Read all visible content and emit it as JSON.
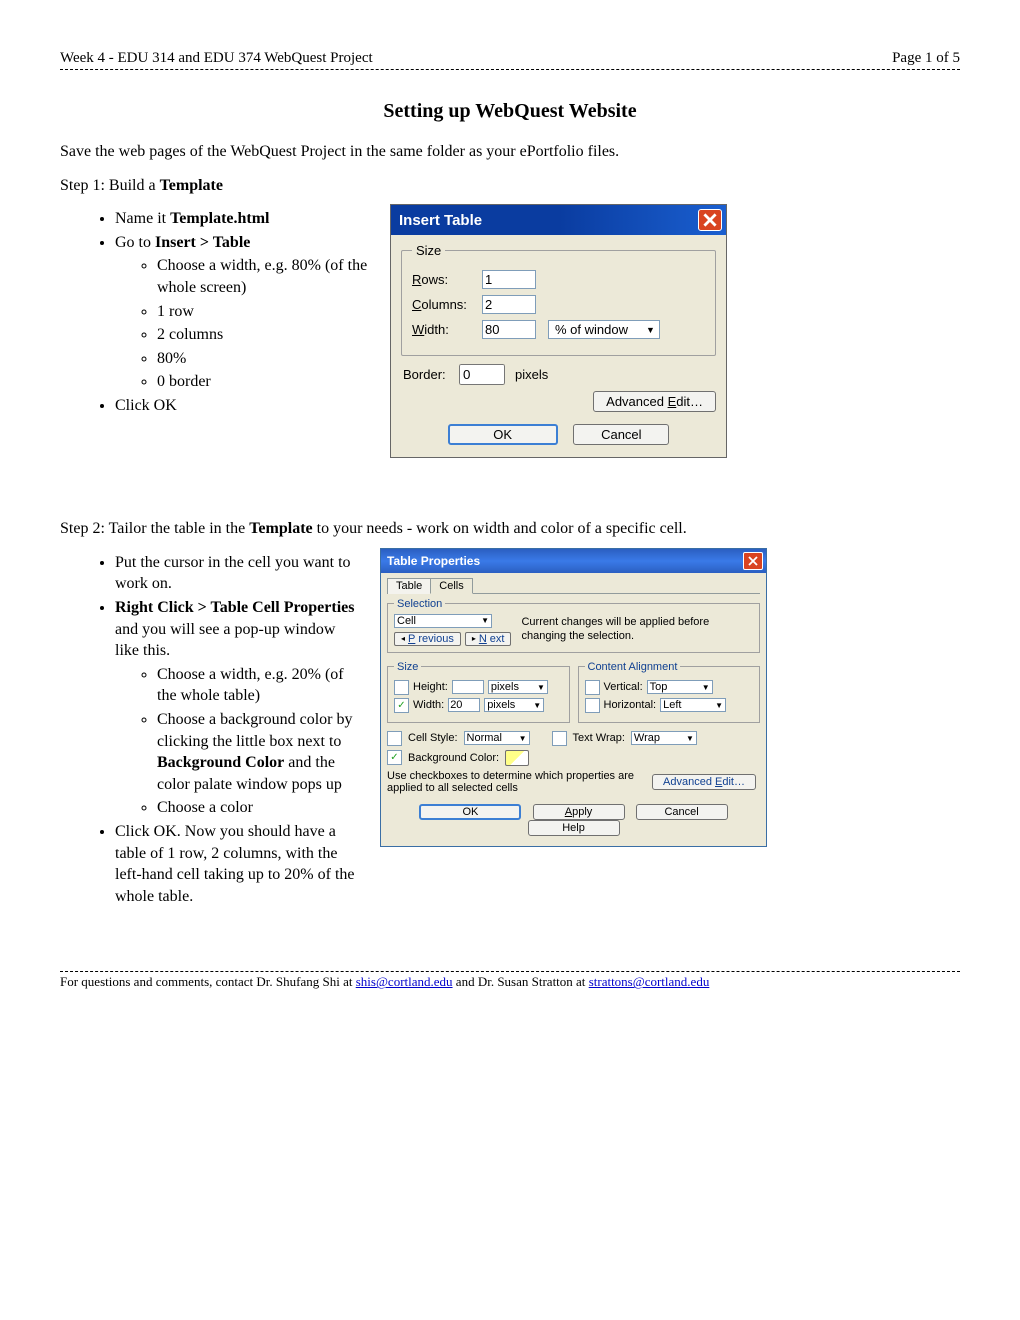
{
  "header": {
    "left": "Week 4 - EDU 314 and EDU 374 WebQuest Project",
    "right": "Page 1 of 5"
  },
  "title": "Setting up WebQuest Website",
  "intro": "Save the web pages of the WebQuest Project in the same folder as your ePortfolio files.",
  "step1": {
    "heading_prefix": "Step 1: Build a ",
    "heading_bold": "Template",
    "b1_prefix": "Name it ",
    "b1_bold": "Template.html",
    "b2_prefix": "Go to ",
    "b2_bold": "Insert > Table",
    "sub1": "Choose a width, e.g. 80% (of the whole screen)",
    "sub2": "1 row",
    "sub3": "2 columns",
    "sub4": "80%",
    "sub5": "0 border",
    "b3": "Click OK"
  },
  "dlg1": {
    "title": "Insert Table",
    "size_legend": "Size",
    "rows_lbl": "Rows:",
    "rows_u": "R",
    "rows_val": "1",
    "cols_lbl": "Columns:",
    "cols_u": "C",
    "cols_val": "2",
    "width_lbl": "Width:",
    "width_u": "W",
    "width_val": "80",
    "width_unit": "% of window",
    "border_lbl": "Border:",
    "border_u": "B",
    "border_val": "0",
    "border_unit": "pixels",
    "adv": "Advanced Edit…",
    "adv_u": "E",
    "ok": "OK",
    "cancel": "Cancel"
  },
  "step2": {
    "heading_prefix": "Step 2: Tailor the table in the ",
    "heading_bold": "Template",
    "heading_suffix": " to your needs - work on width and color of a specific cell.",
    "b1": "Put the cursor in the cell you want to work on.",
    "b2_bold": "Right Click > Table Cell Properties",
    "b2_suffix": " and you will see a pop-up window like this.",
    "sub1": "Choose a width, e.g. 20% (of the whole table)",
    "sub2_prefix": "Choose a background color by clicking the little box next to ",
    "sub2_bold": "Background Color",
    "sub2_suffix": " and the color palate window pops up",
    "sub3": "Choose a color",
    "b3": "Click OK. Now you should have a table of 1 row, 2 columns, with the left-hand cell taking up to 20% of the whole table."
  },
  "dlg2": {
    "title": "Table Properties",
    "tab_table": "Table",
    "tab_cells": "Cells",
    "sel_legend": "Selection",
    "sel_cell": "Cell",
    "prev": "Previous",
    "next": "Next",
    "sel_text": "Current changes will be applied before changing the selection.",
    "size_legend": "Size",
    "height_lbl": "Height:",
    "width_lbl": "Width:",
    "width_val": "20",
    "unit_pixels": "pixels",
    "align_legend": "Content Alignment",
    "vert_lbl": "Vertical:",
    "vert_val": "Top",
    "horz_lbl": "Horizontal:",
    "horz_val": "Left",
    "cellstyle_lbl": "Cell Style:",
    "cellstyle_val": "Normal",
    "textwrap_lbl": "Text Wrap:",
    "textwrap_val": "Wrap",
    "bgcolor_lbl": "Background Color:",
    "note": "Use checkboxes to determine which properties are applied to all selected cells",
    "adv": "Advanced Edit…",
    "ok": "OK",
    "apply": "Apply",
    "cancel": "Cancel",
    "help": "Help"
  },
  "footer": {
    "text_prefix": "For questions and comments, contact Dr. Shufang Shi at ",
    "email1": "shis@cortland.edu",
    "text_mid": " and Dr. Susan Stratton at ",
    "email2": "strattons@cortland.edu"
  }
}
